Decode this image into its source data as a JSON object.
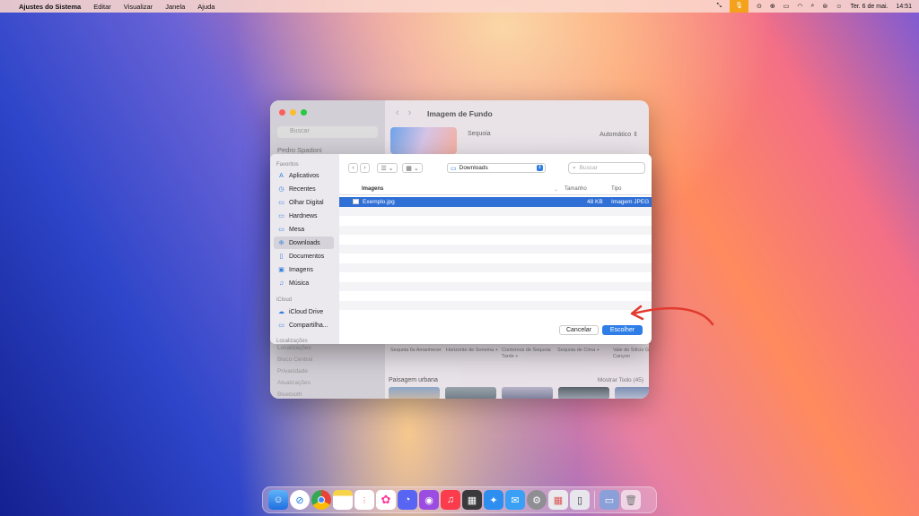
{
  "menubar": {
    "app": "Ajustes do Sistema",
    "items": [
      "Editar",
      "Visualizar",
      "Janela",
      "Ajuda"
    ],
    "date": "Ter. 6 de mai.",
    "time": "14:51"
  },
  "background_window": {
    "title": "Imagem de Fundo",
    "search_placeholder": "Buscar",
    "profile": "Pedro Spadoni",
    "option": "Sequoia",
    "mode": "Automático ⇕",
    "captions": [
      "Sequoia 6s Amanhecer",
      "Horizonte de Sonoma +",
      "Contornos de Sequoia Tarde +",
      "Sequoia de Cima +",
      "Vale do Silício Grand Canyon"
    ],
    "section": "Paisagem urbana",
    "show_all": "Mostrar Todo (45)",
    "sidebar_bottom": [
      "Localizações",
      "Bloco Central",
      "Privacidade",
      "Atualizações",
      "Bluetooth"
    ]
  },
  "dialog": {
    "sidebar": {
      "favorites_label": "Favoritos",
      "favorites": [
        {
          "label": "Aplicativos",
          "icon": "A"
        },
        {
          "label": "Recentes",
          "icon": "◷"
        },
        {
          "label": "Olhar Digital",
          "icon": "▭"
        },
        {
          "label": "Hardnews",
          "icon": "▭"
        },
        {
          "label": "Mesa",
          "icon": "▭"
        },
        {
          "label": "Downloads",
          "icon": "⊕",
          "selected": true
        },
        {
          "label": "Documentos",
          "icon": "▯"
        },
        {
          "label": "Imagens",
          "icon": "▣"
        },
        {
          "label": "Música",
          "icon": "♫"
        }
      ],
      "icloud_label": "iCloud",
      "icloud": [
        {
          "label": "iCloud Drive",
          "icon": "☁"
        },
        {
          "label": "Compartilha...",
          "icon": "▭"
        }
      ],
      "locations_label": "Localizações"
    },
    "toolbar": {
      "back": "‹",
      "forward": "›",
      "list_view": "☰ ⌄",
      "grid_view": "▦ ⌄",
      "location": "Downloads",
      "search_placeholder": "Buscar"
    },
    "columns": {
      "name": "Imagens",
      "size": "Tamanho",
      "kind": "Tipo"
    },
    "files": [
      {
        "name": "Exemplo.jpg",
        "size": "48 KB",
        "kind": "Imagem JPEG"
      }
    ],
    "cancel": "Cancelar",
    "choose": "Escolher"
  },
  "accent_color": "#2f7ee8",
  "dock_apps": [
    "finder-icon",
    "safari-icon",
    "chrome-icon",
    "notes-icon",
    "reminders-icon",
    "photos-icon",
    "discord-icon",
    "podcasts-icon",
    "music-icon",
    "calculator-icon",
    "appstore-icon",
    "mail-icon",
    "settings-icon",
    "launchpad-icon",
    "iphone-mirroring-icon",
    "downloads-stack-icon",
    "trash-icon"
  ]
}
